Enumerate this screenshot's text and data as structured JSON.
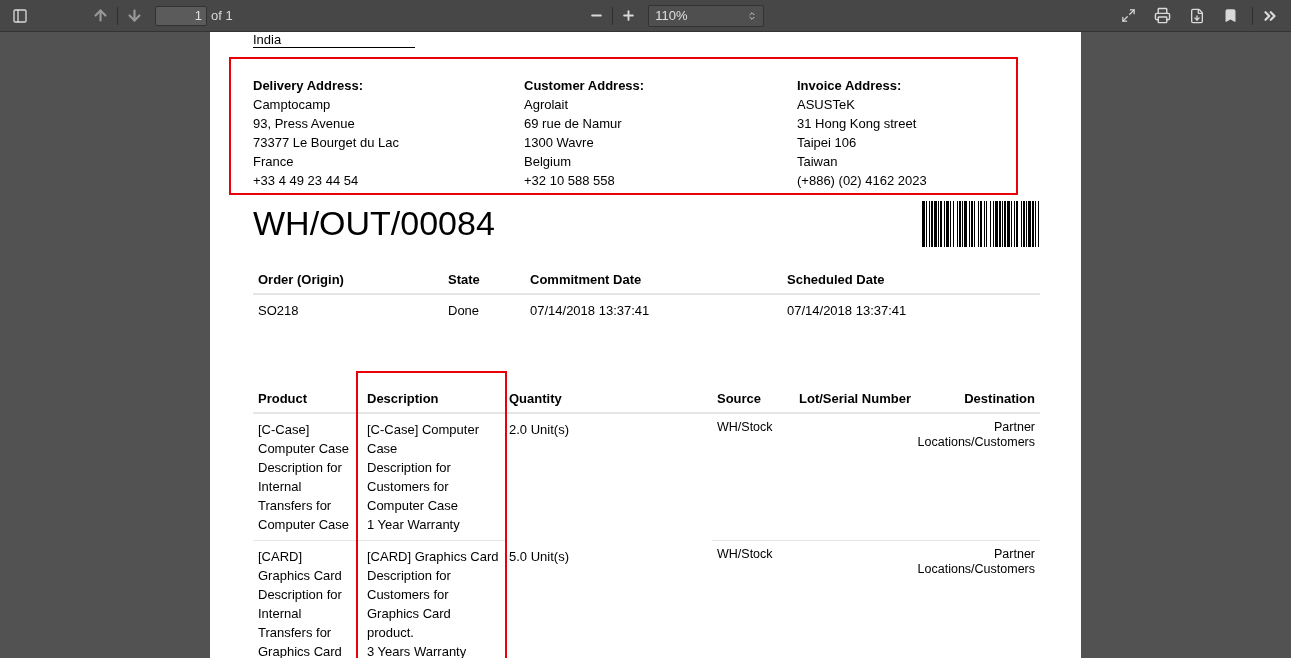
{
  "toolbar": {
    "page_number": "1",
    "page_count": "of 1",
    "zoom": "110%"
  },
  "document": {
    "top_line": "India",
    "addresses": [
      {
        "heading": "Delivery Address:",
        "lines": [
          "Camptocamp",
          "93, Press Avenue",
          "73377 Le Bourget du Lac",
          "France",
          "+33 4 49 23 44 54"
        ]
      },
      {
        "heading": "Customer Address:",
        "lines": [
          "Agrolait",
          "69 rue de Namur",
          "1300 Wavre",
          "Belgium",
          "+32 10 588 558"
        ]
      },
      {
        "heading": "Invoice Address:",
        "lines": [
          "ASUSTeK",
          "31 Hong Kong street",
          "Taipei 106",
          "Taiwan",
          "(+886) (02) 4162 2023"
        ]
      }
    ],
    "title": "WH/OUT/00084",
    "info_table": {
      "columns": [
        "Order (Origin)",
        "State",
        "Commitment Date",
        "Scheduled Date"
      ],
      "rows": [
        [
          "SO218",
          "Done",
          "07/14/2018 13:37:41",
          "07/14/2018 13:37:41"
        ]
      ]
    },
    "lines_table": {
      "columns": [
        "Product",
        "Description",
        "Quantity",
        "Source",
        "Lot/Serial Number",
        "Destination"
      ],
      "rows": [
        {
          "product": [
            "[C-Case]",
            "Computer Case",
            "Description for",
            "Internal",
            "Transfers for",
            "Computer Case"
          ],
          "description": [
            "[C-Case] Computer",
            "Case",
            "Description for",
            "Customers for",
            "Computer Case",
            "1 Year Warranty"
          ],
          "quantity": "2.0 Unit(s)",
          "source": "WH/Stock",
          "destination": [
            "Partner",
            "Locations/Customers"
          ]
        },
        {
          "product": [
            "[CARD]",
            "Graphics Card",
            "Description for",
            "Internal",
            "Transfers for",
            "Graphics Card"
          ],
          "description": [
            "[CARD] Graphics Card",
            "Description for",
            "Customers for",
            "Graphics Card",
            "product.",
            "3 Years Warranty"
          ],
          "quantity": "5.0 Unit(s)",
          "source": "WH/Stock",
          "destination": [
            "Partner",
            "Locations/Customers"
          ]
        }
      ]
    }
  }
}
